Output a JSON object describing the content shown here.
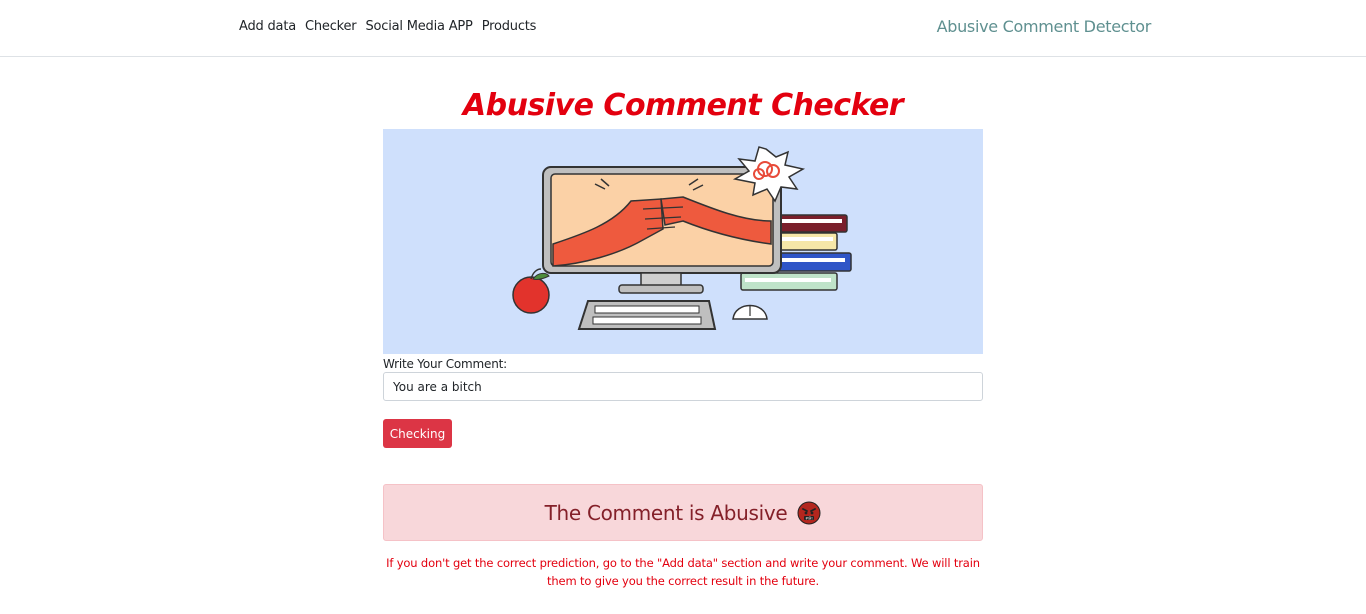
{
  "nav": {
    "links": [
      "Add data",
      "Checker",
      "Social Media APP",
      "Products"
    ],
    "brand": "Abusive Comment Detector"
  },
  "main": {
    "title": "Abusive Comment Checker",
    "hero_image": "computer-fist-bump-illustration",
    "comment_label": "Write Your Comment:",
    "comment_value": "You are a bitch",
    "check_button": "Checking",
    "result_text": "The Comment is Abusive",
    "result_icon": "angry-face-icon",
    "note": "If you don't get the correct prediction, go to the \"Add data\" section and write your comment. We will train them to give you the correct result in the future."
  },
  "colors": {
    "title": "#e3000f",
    "brand": "#5f9090",
    "button": "#dc3545",
    "alert_bg": "#f8d7da",
    "alert_text": "#842029",
    "hero_bg": "#cfe0fc"
  }
}
